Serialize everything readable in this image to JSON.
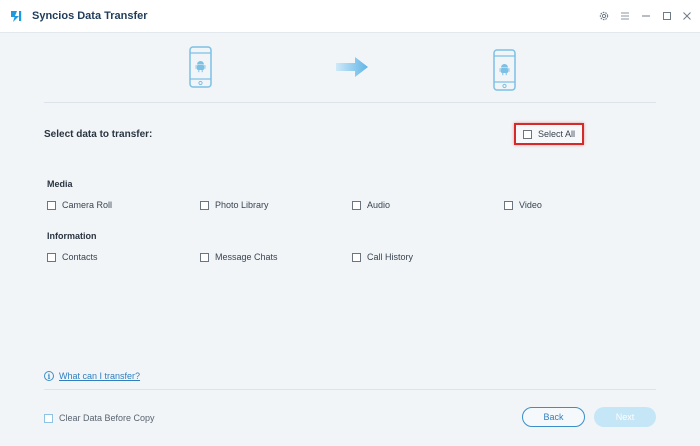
{
  "titlebar": {
    "title": "Syncios Data Transfer",
    "icons": [
      "app-logo-icon",
      "gear-icon",
      "menu-icon",
      "minimize-icon",
      "maximize-icon",
      "close-icon"
    ]
  },
  "devices": {
    "source_icon": "android-phone-icon",
    "target_icon": "android-phone-icon",
    "arrow_icon": "arrow-right-icon"
  },
  "selection": {
    "title": "Select data to transfer:",
    "select_all_label": "Select All",
    "groups": [
      {
        "label": "Media",
        "options": [
          "Camera Roll",
          "Photo Library",
          "Audio",
          "Video"
        ]
      },
      {
        "label": "Information",
        "options": [
          "Contacts",
          "Message Chats",
          "Call History"
        ]
      }
    ]
  },
  "footer": {
    "help_link": "What can I transfer?",
    "clear_data_label": "Clear Data Before Copy",
    "back_label": "Back",
    "next_label": "Next"
  },
  "colors": {
    "accent": "#3b8ec9",
    "highlight_border": "#d42a2a",
    "next_disabled": "#c5e6f7",
    "background": "#f1f5f8"
  }
}
